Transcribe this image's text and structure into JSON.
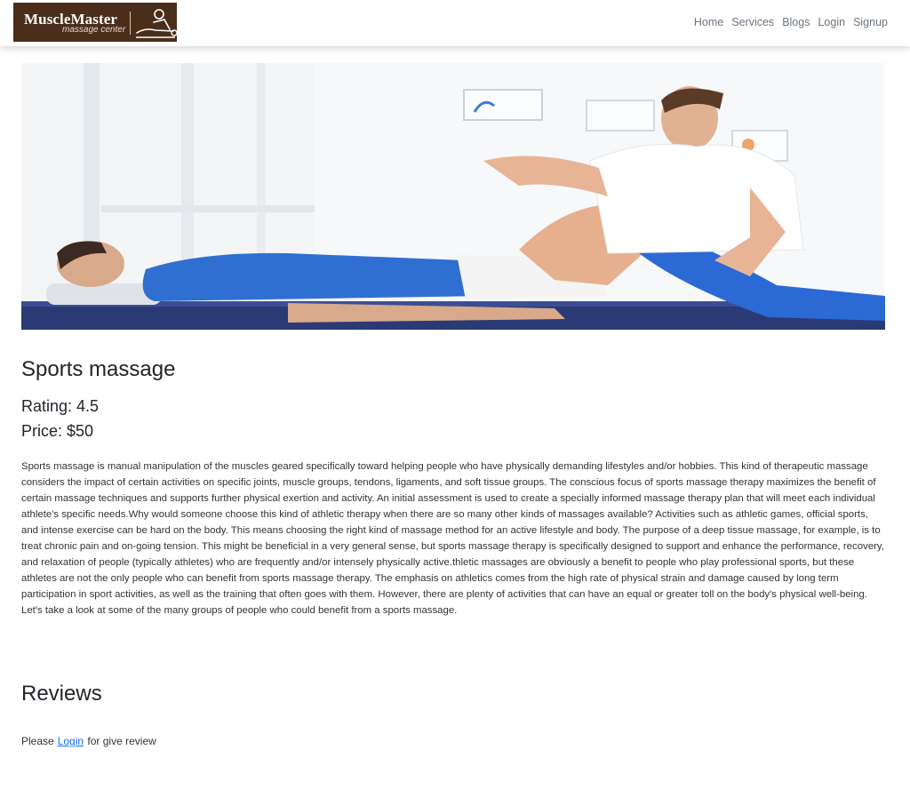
{
  "brand": {
    "name": "MuscleMaster",
    "tagline": "massage center",
    "logo_icon": "massage-person-icon"
  },
  "nav": {
    "items": [
      {
        "label": "Home"
      },
      {
        "label": "Services"
      },
      {
        "label": "Blogs"
      },
      {
        "label": "Login"
      },
      {
        "label": "Signup"
      }
    ]
  },
  "hero": {
    "image": "therapist-stretching-athlete-leg-photo"
  },
  "service": {
    "title": "Sports massage",
    "rating": "Rating: 4.5",
    "price": "Price: $50",
    "description": "Sports massage is manual manipulation of the muscles geared specifically toward helping people who have physically demanding lifestyles and/or hobbies. This kind of therapeutic massage considers the impact of certain activities on specific joints, muscle groups, tendons, ligaments, and soft tissue groups. The conscious focus of sports massage therapy maximizes the benefit of certain massage techniques and supports further physical exertion and activity. An initial assessment is used to create a specially informed massage therapy plan that will meet each individual athlete's specific needs.Why would someone choose this kind of athletic therapy when there are so many other kinds of massages available? Activities such as athletic games, official sports, and intense exercise can be hard on the body. This means choosing the right kind of massage method for an active lifestyle and body. The purpose of a deep tissue massage, for example, is to treat chronic pain and on-going tension. This might be beneficial in a very general sense, but sports massage therapy is specifically designed to support and enhance the performance, recovery, and relaxation of people (typically athletes) who are frequently and/or intensely physically active.thletic massages are obviously a benefit to people who play professional sports, but these athletes are not the only people who can benefit from sports massage therapy. The emphasis on athletics comes from the high rate of physical strain and damage caused by long term participation in sport activities, as well as the training that often goes with them. However, there are plenty of activities that can have an equal or greater toll on the body's physical well-being. Let's take a look at some of the many groups of people who could benefit from a sports massage."
  },
  "reviews": {
    "heading": "Reviews",
    "prefix": "Please",
    "login_link": "Login",
    "suffix": "for give review"
  },
  "colors": {
    "brand_bg": "#4a2e1a",
    "link": "#0d6efd",
    "nav_text": "#6c757d"
  }
}
